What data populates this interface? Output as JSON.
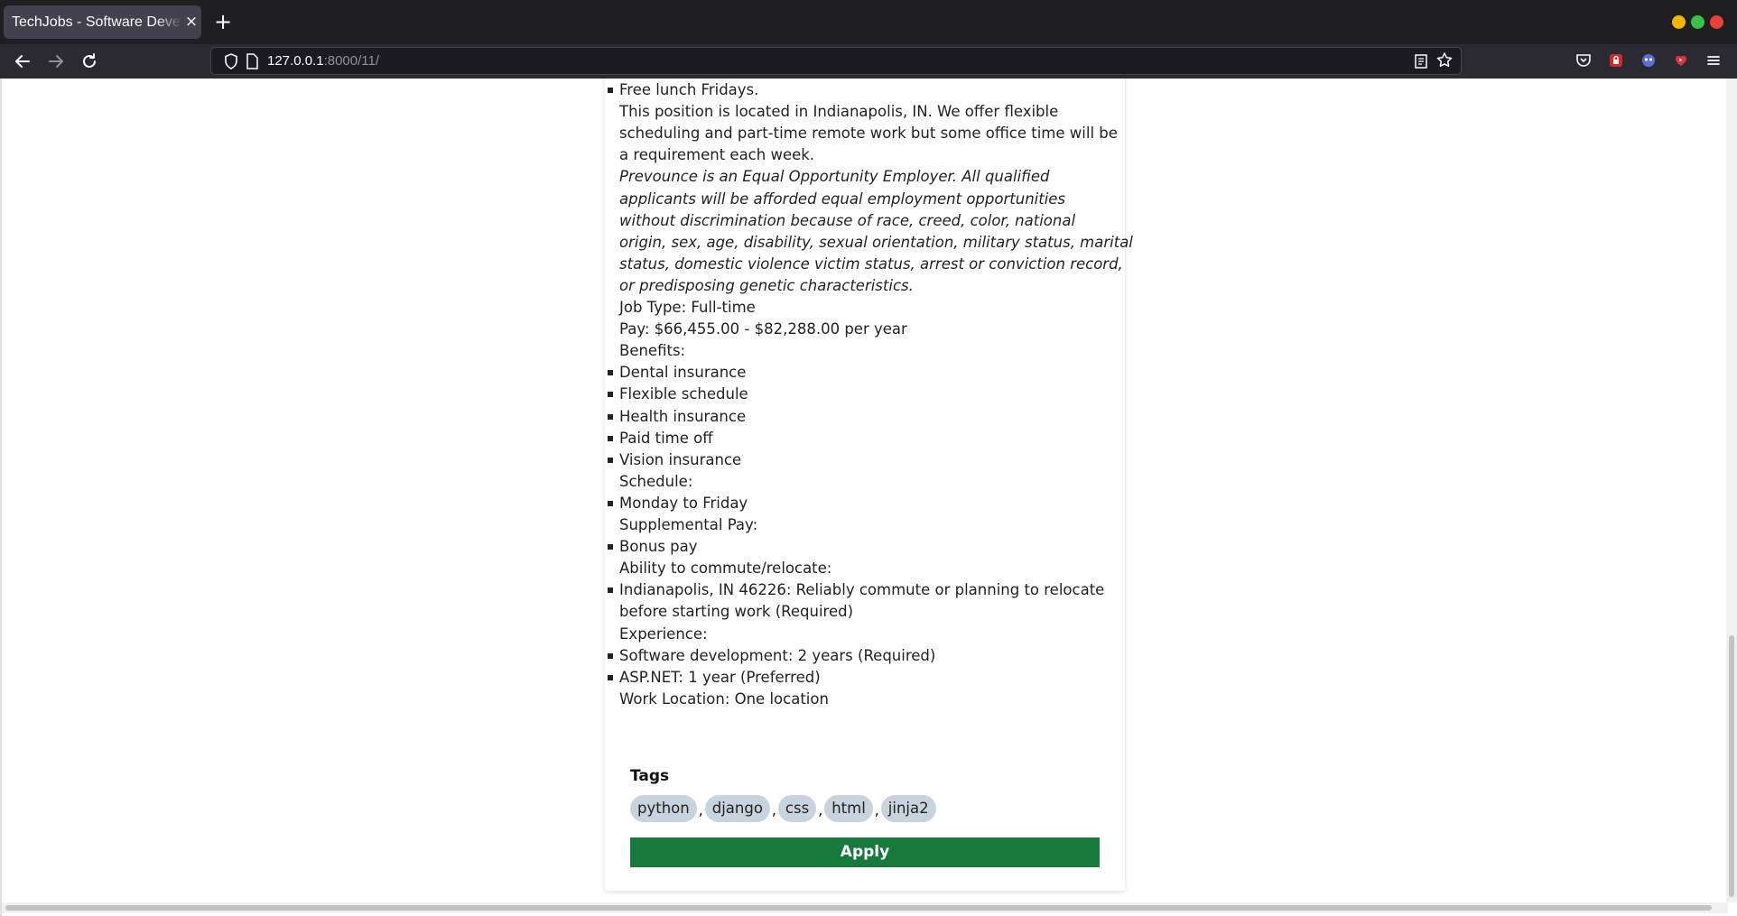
{
  "browser": {
    "tab_title": "TechJobs - Software Developer",
    "tab_close": "×",
    "new_tab": "+",
    "url_host": "127.0.0.1",
    "url_rest": ":8000/11/"
  },
  "job": {
    "lines": [
      {
        "text": "Free lunch Fridays.",
        "bullet": true
      },
      {
        "text": "This position is located in Indianapolis, IN. We offer flexible",
        "bullet": false
      },
      {
        "text": "scheduling and part-time remote work but some office time will be",
        "bullet": false
      },
      {
        "text": "a requirement each week.",
        "bullet": false
      },
      {
        "text": "Prevounce is an Equal Opportunity Employer. All qualified",
        "bullet": false,
        "italic": true
      },
      {
        "text": "applicants will be afforded equal employment opportunities",
        "bullet": false,
        "italic": true
      },
      {
        "text": "without discrimination because of race, creed, color, national",
        "bullet": false,
        "italic": true
      },
      {
        "text": "origin, sex, age, disability, sexual orientation, military status, marital",
        "bullet": false,
        "italic": true
      },
      {
        "text": "status, domestic violence victim status, arrest or conviction record,",
        "bullet": false,
        "italic": true
      },
      {
        "text": "or predisposing genetic characteristics.",
        "bullet": false,
        "italic": true
      },
      {
        "text": "Job Type: Full-time",
        "bullet": false
      },
      {
        "text": "Pay: $66,455.00 - $82,288.00 per year",
        "bullet": false
      },
      {
        "text": "Benefits:",
        "bullet": false
      },
      {
        "text": "Dental insurance",
        "bullet": true
      },
      {
        "text": "Flexible schedule",
        "bullet": true
      },
      {
        "text": "Health insurance",
        "bullet": true
      },
      {
        "text": "Paid time off",
        "bullet": true
      },
      {
        "text": "Vision insurance",
        "bullet": true
      },
      {
        "text": "Schedule:",
        "bullet": false
      },
      {
        "text": "Monday to Friday",
        "bullet": true
      },
      {
        "text": "Supplemental Pay:",
        "bullet": false
      },
      {
        "text": "Bonus pay",
        "bullet": true
      },
      {
        "text": "Ability to commute/relocate:",
        "bullet": false
      },
      {
        "text": "Indianapolis, IN 46226: Reliably commute or planning to relocate",
        "bullet": true
      },
      {
        "text": "before starting work (Required)",
        "bullet": false
      },
      {
        "text": "Experience:",
        "bullet": false
      },
      {
        "text": "Software development: 2 years (Required)",
        "bullet": true
      },
      {
        "text": "ASP.NET: 1 year (Preferred)",
        "bullet": true
      },
      {
        "text": "Work Location: One location",
        "bullet": false
      }
    ]
  },
  "tags": {
    "title": "Tags",
    "items": [
      "python",
      "django",
      "css",
      "html",
      "jinja2"
    ],
    "separator": ","
  },
  "apply_label": "Apply"
}
